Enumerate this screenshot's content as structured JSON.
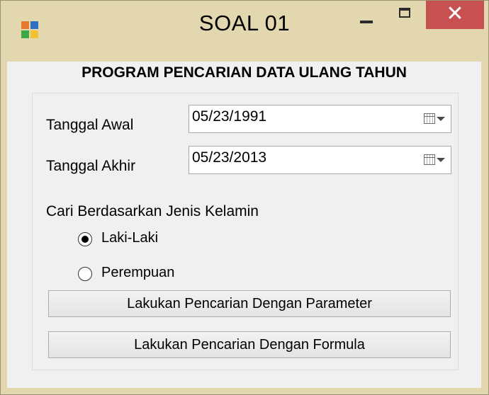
{
  "window": {
    "title": "SOAL 01",
    "close_glyph": "✕"
  },
  "form": {
    "heading": "PROGRAM PENCARIAN DATA ULANG TAHUN",
    "start_date": {
      "label": "Tanggal Awal",
      "value": "05/23/1991"
    },
    "end_date": {
      "label": "Tanggal Akhir",
      "value": "05/23/2013"
    },
    "gender": {
      "label": "Cari Berdasarkan Jenis Kelamin",
      "options": [
        {
          "label": "Laki-Laki",
          "selected": true
        },
        {
          "label": "Perempuan",
          "selected": false
        }
      ]
    },
    "buttons": {
      "search_parameter": "Lakukan Pencarian Dengan Parameter",
      "search_formula": "Lakukan Pencarian Dengan Formula"
    }
  },
  "colors": {
    "window_frame": "#e3d7b0",
    "close_button": "#c75050",
    "client_background": "#f0f0f0"
  },
  "icons": {
    "app": "app-icon",
    "calendar": "calendar-icon",
    "dropdown": "chevron-down-icon"
  }
}
